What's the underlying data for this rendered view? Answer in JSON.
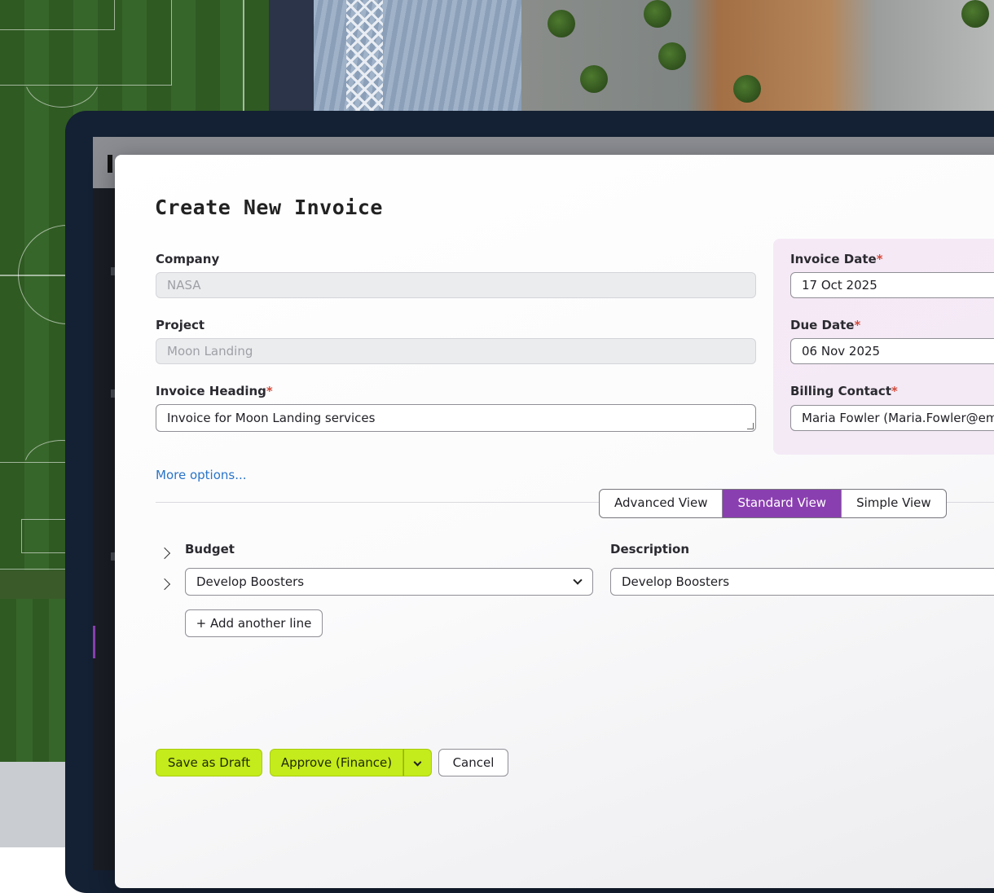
{
  "form": {
    "title": "Create New Invoice",
    "company": {
      "label": "Company",
      "value": "NASA"
    },
    "project": {
      "label": "Project",
      "value": "Moon Landing"
    },
    "heading": {
      "label": "Invoice Heading",
      "required_mark": "*",
      "value": "Invoice for Moon Landing services"
    },
    "invoice_date": {
      "label": "Invoice Date",
      "required_mark": "*",
      "value": "17 Oct 2025"
    },
    "due_date": {
      "label": "Due Date",
      "required_mark": "*",
      "value": "06 Nov 2025"
    },
    "billing_contact": {
      "label": "Billing Contact",
      "required_mark": "*",
      "value": "Maria Fowler (Maria.Fowler@email.com)"
    },
    "more_options": "More options..."
  },
  "views": {
    "selected": "Standard View",
    "items": [
      "Advanced View",
      "Standard View",
      "Simple View"
    ]
  },
  "lines": {
    "budget_label": "Budget",
    "description_label": "Description",
    "rows": [
      {
        "budget": "Develop Boosters",
        "description": "Develop Boosters"
      }
    ],
    "add_line": "+ Add another line"
  },
  "actions": {
    "save_draft": "Save as Draft",
    "approve": "Approve (Finance)",
    "cancel": "Cancel"
  },
  "colors": {
    "accent_purple": "#8a3fb0",
    "action_lime": "#c4eb1b",
    "link_blue": "#2a74c8",
    "required_red": "#d14a3a"
  }
}
